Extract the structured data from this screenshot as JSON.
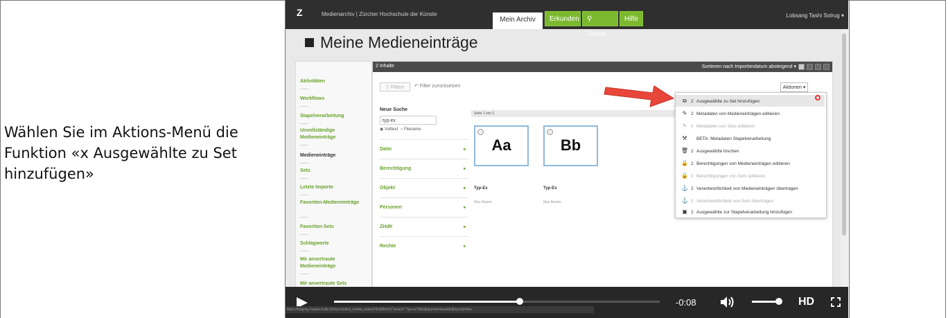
{
  "instruction": "Wählen Sie im Aktions-Menü die Funktion «x Ausgewählte zu Set hinzufügen»",
  "app": {
    "logo": "Z",
    "title": "Medienarchiv | Zürcher Hochschule der Künste",
    "tabs": {
      "mein_archiv": "Mein Archiv",
      "erkunden": "Erkunden",
      "suche": "Suche",
      "hilfe": "Hilfe"
    },
    "user": "Lobsang Tashi Sotrug ▾"
  },
  "page_heading": "Meine Medieneinträge",
  "sidebar": [
    "Aktivitäten",
    "Workflows",
    "Stapelverarbeitung",
    "Unvollständige Medieneinträge",
    "Medieneinträge",
    "Sets",
    "Letzte Importe",
    "Favoriten-Medieneinträge",
    "Favoriten-Sets",
    "Schlagworte",
    "Mir anvertraute Medieneinträge",
    "Mir anvertraute Sets"
  ],
  "content": {
    "count": "2 Inhalte",
    "sort": "Sortieren nach Importierdatum absteigend ▾",
    "filter_button": "▽ Filtern",
    "reset_filter": "↶ Filter zurücksetzen",
    "actions_button": "Aktionen ▾",
    "new_search_label": "Neue Suche",
    "search_value": "typ-ex",
    "radio_fulltext": "◉ Volltext",
    "radio_filename": "○ Filename",
    "facets": [
      "Datei",
      "Berechtigung",
      "Objekt",
      "Personen",
      "ZHdK",
      "Rechte"
    ],
    "page_info": "Seite 1 von 1",
    "cards": [
      {
        "glyph": "Aa",
        "title": "Typ-Ex",
        "author": "Max Muster"
      },
      {
        "glyph": "Bb",
        "title": "Typ-Ex",
        "author": "Max Muster"
      }
    ]
  },
  "actions_menu": [
    {
      "icon": "⧉",
      "num": "2",
      "label": "Ausgewählte zu Set hinzufügen",
      "enabled": true
    },
    {
      "icon": "✎",
      "num": "2",
      "label": "Metadaten von Medieneinträgen editieren",
      "enabled": true
    },
    {
      "icon": "✎",
      "num": "0",
      "label": "Metadaten von Sets editieren",
      "enabled": false
    },
    {
      "icon": "⚒",
      "num": "",
      "label": "BETA: Metadaten Stapelverarbeitung",
      "enabled": true
    },
    {
      "icon": "🗑",
      "num": "2",
      "label": "Ausgewählte löschen",
      "enabled": true
    },
    {
      "icon": "🔒",
      "num": "2",
      "label": "Berechtigungen von Medieneinträgen editieren",
      "enabled": true
    },
    {
      "icon": "🔒",
      "num": "0",
      "label": "Berechtigungen von Sets editieren",
      "enabled": false
    },
    {
      "icon": "⚓",
      "num": "2",
      "label": "Verantwortlichkeit von Medieneinträgen übertragen",
      "enabled": true
    },
    {
      "icon": "⚓",
      "num": "0",
      "label": "Verantwortlichkeit von Sets übertragen",
      "enabled": false
    },
    {
      "icon": "▣",
      "num": "2",
      "label": "Ausgewählte zur Stapelverarbeitung hinzufügen",
      "enabled": true
    }
  ],
  "player": {
    "time": "-0:08",
    "hd": "HD",
    "progress": 0.57,
    "volume": 0.9
  },
  "status_url": "https://staging.madek.zhdk.ch/my/content_media_entries?list[filter]={\"search\":\"typ-ex\"}&list[sparse]=true&list[layout]=tiles"
}
